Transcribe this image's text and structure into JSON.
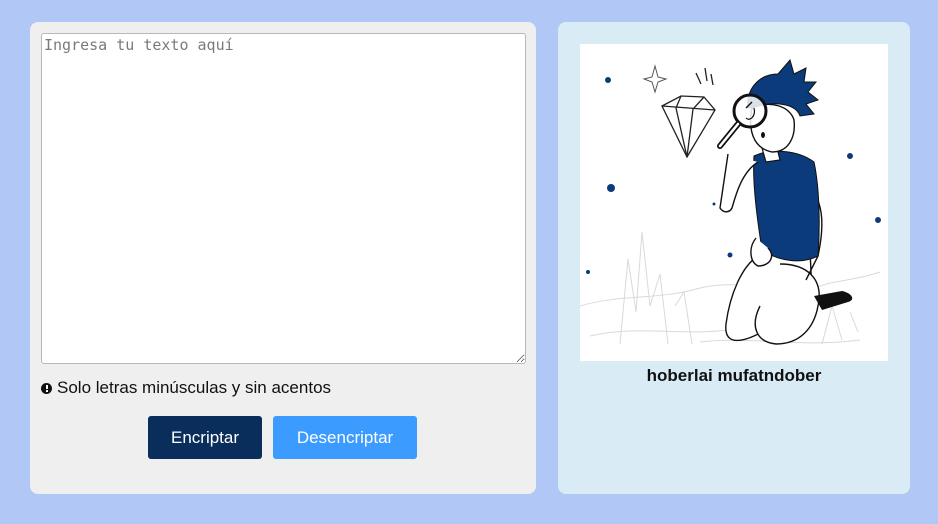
{
  "input": {
    "placeholder": "Ingresa tu texto aquí",
    "value": ""
  },
  "hint": {
    "icon": "info-circle-icon",
    "text": "Solo letras minúsculas y sin acentos"
  },
  "buttons": {
    "encrypt_label": "Encriptar",
    "decrypt_label": "Desencriptar"
  },
  "output": {
    "illustration": "person-with-magnifying-glass-and-diamond",
    "text": "hoberlai mufatndober"
  },
  "colors": {
    "page_background": "#b1c7f5",
    "input_panel": "#efefef",
    "output_panel": "#d9ecf6",
    "encrypt_button": "#0a2e5c",
    "decrypt_button": "#3b9bff",
    "illustration_accent": "#0c3b7c"
  }
}
